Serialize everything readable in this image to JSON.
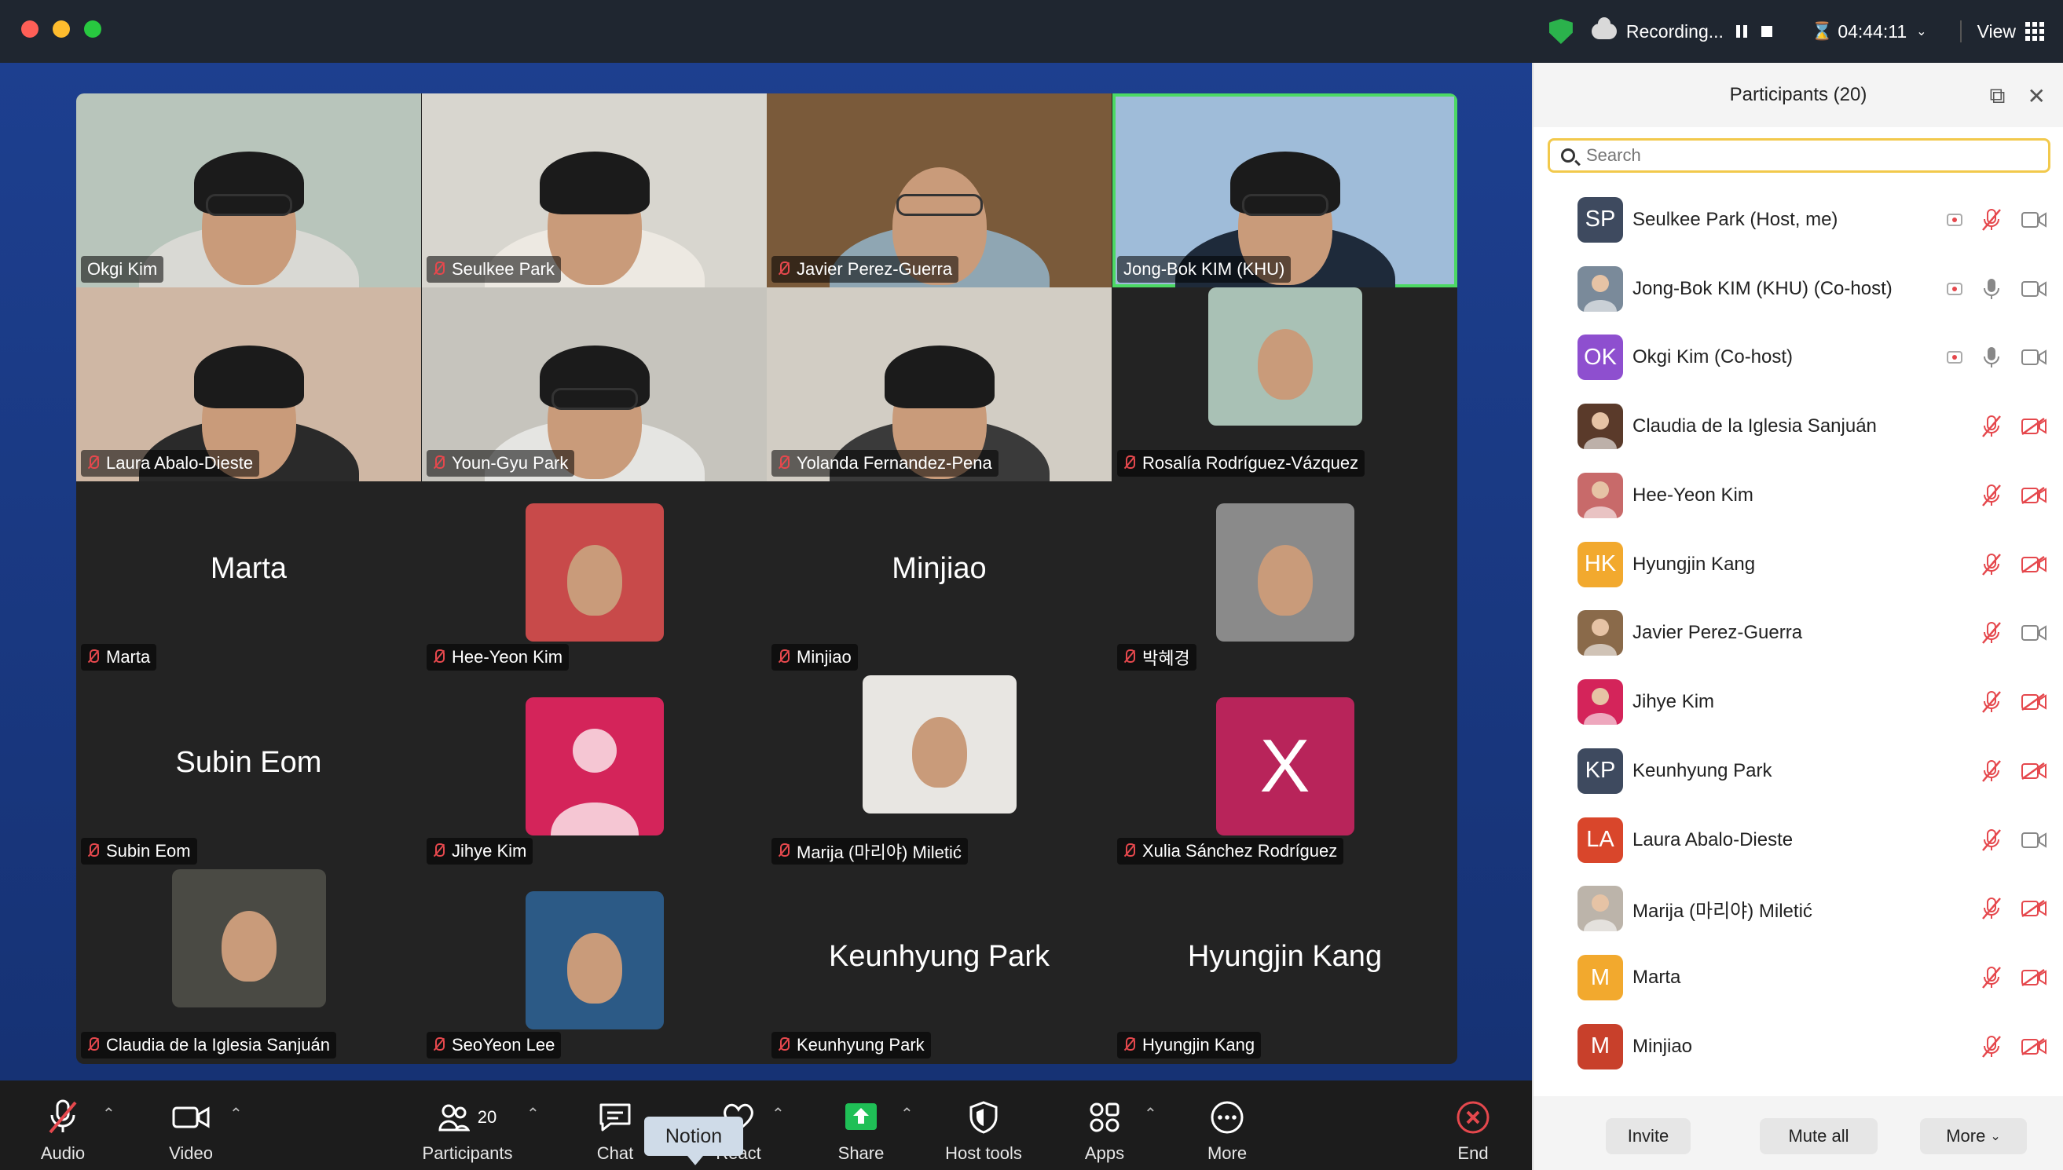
{
  "titlebar": {
    "recording_label": "Recording...",
    "timer": "04:44:11",
    "view_label": "View"
  },
  "gallery": [
    {
      "name": "Okgi Kim",
      "muted": false,
      "kind": "video",
      "bg": "#b8c5bb",
      "shirt": "#d9d9d4",
      "hair": true,
      "glasses": true,
      "speaking": false
    },
    {
      "name": "Seulkee Park",
      "muted": true,
      "kind": "video",
      "bg": "#d8d6cf",
      "shirt": "#ede9e2",
      "hair": true,
      "glasses": false,
      "speaking": false
    },
    {
      "name": "Javier Perez-Guerra",
      "muted": true,
      "kind": "video",
      "bg": "#7a5a3a",
      "shirt": "#8fa6b3",
      "hair": false,
      "glasses": true,
      "speaking": false
    },
    {
      "name": "Jong-Bok KIM (KHU)",
      "muted": false,
      "kind": "video",
      "bg": "#9fbcd9",
      "shirt": "#1e2a3a",
      "hair": true,
      "glasses": true,
      "speaking": true
    },
    {
      "name": "Laura Abalo-Dieste",
      "muted": true,
      "kind": "video",
      "bg": "#cfb7a4",
      "shirt": "#2a2a2a",
      "hair": true,
      "glasses": false,
      "speaking": false
    },
    {
      "name": "Youn-Gyu Park",
      "muted": true,
      "kind": "video",
      "bg": "#c6c4bd",
      "shirt": "#e5e5e2",
      "hair": true,
      "glasses": true,
      "speaking": false
    },
    {
      "name": "Yolanda Fernandez-Pena",
      "muted": true,
      "kind": "video",
      "bg": "#d2cdc4",
      "shirt": "#3a3a3a",
      "hair": true,
      "glasses": false,
      "speaking": false
    },
    {
      "name": "Rosalía Rodríguez-Vázquez",
      "muted": true,
      "kind": "photo",
      "bg": "#a9c1b5",
      "speaking": false
    },
    {
      "name": "Marta",
      "muted": true,
      "kind": "text",
      "speaking": false
    },
    {
      "name": "Hee-Yeon Kim",
      "muted": true,
      "kind": "photo",
      "bg": "#c84a4a",
      "speaking": false
    },
    {
      "name": "Minjiao",
      "muted": true,
      "kind": "text",
      "speaking": false
    },
    {
      "name": "박혜경",
      "muted": true,
      "kind": "photo",
      "bg": "#8a8a8a",
      "speaking": false
    },
    {
      "name": "Subin Eom",
      "muted": true,
      "kind": "text",
      "speaking": false
    },
    {
      "name": "Jihye Kim",
      "muted": true,
      "kind": "avatar",
      "bg": "#d4245a",
      "speaking": false
    },
    {
      "name": "Marija (마리야) Miletić",
      "muted": true,
      "kind": "photo",
      "bg": "#e8e6e2",
      "speaking": false
    },
    {
      "name": "Xulia Sánchez Rodríguez",
      "muted": true,
      "kind": "letter",
      "letter": "X",
      "bg": "#b8245a",
      "speaking": false
    },
    {
      "name": "Claudia de la Iglesia Sanjuán",
      "muted": true,
      "kind": "photo",
      "bg": "#4a4a44",
      "speaking": false
    },
    {
      "name": "SeoYeon Lee",
      "muted": true,
      "kind": "photo",
      "bg": "#2c5a86",
      "speaking": false
    },
    {
      "name": "Keunhyung Park",
      "muted": true,
      "kind": "text",
      "speaking": false
    },
    {
      "name": "Hyungjin Kang",
      "muted": true,
      "kind": "text",
      "speaking": false
    }
  ],
  "toolbar": {
    "audio": "Audio",
    "video": "Video",
    "participants": "Participants",
    "participants_count": "20",
    "chat": "Chat",
    "react": "React",
    "share": "Share",
    "host_tools": "Host tools",
    "apps": "Apps",
    "more": "More",
    "end": "End",
    "tooltip": "Notion"
  },
  "panel": {
    "title": "Participants (20)",
    "search_placeholder": "Search",
    "invite": "Invite",
    "mute_all": "Mute all",
    "more": "More",
    "participants": [
      {
        "initials": "SP",
        "name": "Seulkee Park (Host, me)",
        "color": "#3e4a5f",
        "recording": true,
        "mic_on": false,
        "cam_off": false
      },
      {
        "initials": "",
        "name": "Jong-Bok KIM (KHU) (Co-host)",
        "color": "#7a8a9a",
        "recording": true,
        "mic_on": true,
        "cam_off": false
      },
      {
        "initials": "OK",
        "name": "Okgi Kim (Co-host)",
        "color": "#8e4fcf",
        "recording": true,
        "mic_on": true,
        "cam_off": false
      },
      {
        "initials": "",
        "name": "Claudia de la Iglesia Sanjuán",
        "color": "#5a3a2a",
        "recording": false,
        "mic_on": false,
        "cam_off": true
      },
      {
        "initials": "",
        "name": "Hee-Yeon Kim",
        "color": "#c86a6a",
        "recording": false,
        "mic_on": false,
        "cam_off": true
      },
      {
        "initials": "HK",
        "name": "Hyungjin Kang",
        "color": "#f2a92e",
        "recording": false,
        "mic_on": false,
        "cam_off": true
      },
      {
        "initials": "",
        "name": "Javier Perez-Guerra",
        "color": "#8a6a4a",
        "recording": false,
        "mic_on": false,
        "cam_off": false
      },
      {
        "initials": "",
        "name": "Jihye Kim",
        "color": "#d4245a",
        "recording": false,
        "mic_on": false,
        "cam_off": true
      },
      {
        "initials": "KP",
        "name": "Keunhyung Park",
        "color": "#3e4a5f",
        "recording": false,
        "mic_on": false,
        "cam_off": true
      },
      {
        "initials": "LA",
        "name": "Laura Abalo-Dieste",
        "color": "#d9462b",
        "recording": false,
        "mic_on": false,
        "cam_off": false
      },
      {
        "initials": "",
        "name": "Marija (마리야) Miletić",
        "color": "#bcb4aa",
        "recording": false,
        "mic_on": false,
        "cam_off": true
      },
      {
        "initials": "M",
        "name": "Marta",
        "color": "#f2a92e",
        "recording": false,
        "mic_on": false,
        "cam_off": true
      },
      {
        "initials": "M",
        "name": "Minjiao",
        "color": "#c8402b",
        "recording": false,
        "mic_on": false,
        "cam_off": true
      }
    ]
  },
  "colors": {
    "speaking_outline": "#4cd964",
    "muted_red": "#e5484d",
    "search_border": "#f2c94c",
    "share_green": "#1fbf56",
    "end_red": "#e5484d"
  }
}
